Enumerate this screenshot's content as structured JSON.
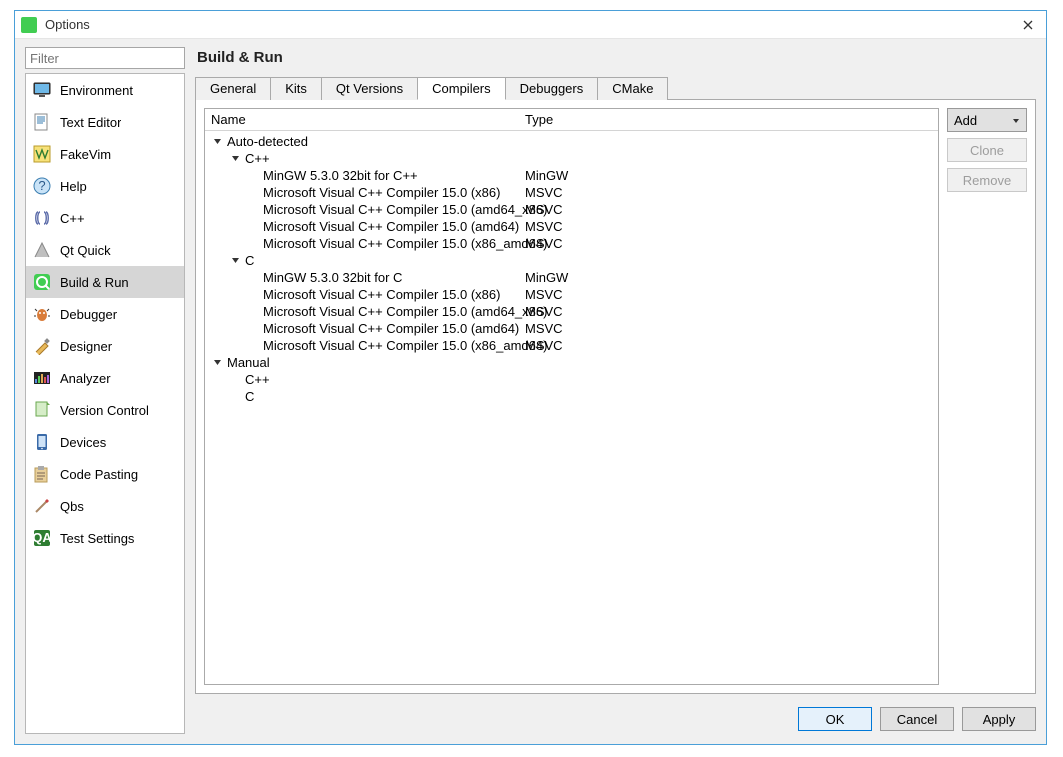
{
  "window": {
    "title": "Options"
  },
  "filter": {
    "placeholder": "Filter"
  },
  "sidebar": {
    "items": [
      {
        "id": "environment",
        "label": "Environment"
      },
      {
        "id": "text-editor",
        "label": "Text Editor"
      },
      {
        "id": "fakevim",
        "label": "FakeVim"
      },
      {
        "id": "help",
        "label": "Help"
      },
      {
        "id": "cpp",
        "label": "C++"
      },
      {
        "id": "qt-quick",
        "label": "Qt Quick"
      },
      {
        "id": "build-run",
        "label": "Build & Run"
      },
      {
        "id": "debugger",
        "label": "Debugger"
      },
      {
        "id": "designer",
        "label": "Designer"
      },
      {
        "id": "analyzer",
        "label": "Analyzer"
      },
      {
        "id": "version-control",
        "label": "Version Control"
      },
      {
        "id": "devices",
        "label": "Devices"
      },
      {
        "id": "code-pasting",
        "label": "Code Pasting"
      },
      {
        "id": "qbs",
        "label": "Qbs"
      },
      {
        "id": "test-settings",
        "label": "Test Settings"
      }
    ],
    "selected": "build-run"
  },
  "page": {
    "title": "Build & Run"
  },
  "tabs": {
    "items": [
      "General",
      "Kits",
      "Qt Versions",
      "Compilers",
      "Debuggers",
      "CMake"
    ],
    "active": "Compilers"
  },
  "tree": {
    "columns": {
      "name": "Name",
      "type": "Type"
    },
    "rows": [
      {
        "depth": 0,
        "exp": true,
        "name": "Auto-detected",
        "type": ""
      },
      {
        "depth": 1,
        "exp": true,
        "name": "C++",
        "type": ""
      },
      {
        "depth": 2,
        "exp": false,
        "name": "MinGW 5.3.0 32bit for C++",
        "type": "MinGW"
      },
      {
        "depth": 2,
        "exp": false,
        "name": "Microsoft Visual C++ Compiler 15.0 (x86)",
        "type": "MSVC"
      },
      {
        "depth": 2,
        "exp": false,
        "name": "Microsoft Visual C++ Compiler 15.0 (amd64_x86)",
        "type": "MSVC"
      },
      {
        "depth": 2,
        "exp": false,
        "name": "Microsoft Visual C++ Compiler 15.0 (amd64)",
        "type": "MSVC"
      },
      {
        "depth": 2,
        "exp": false,
        "name": "Microsoft Visual C++ Compiler 15.0 (x86_amd64)",
        "type": "MSVC"
      },
      {
        "depth": 1,
        "exp": true,
        "name": "C",
        "type": ""
      },
      {
        "depth": 2,
        "exp": false,
        "name": "MinGW 5.3.0 32bit for C",
        "type": "MinGW"
      },
      {
        "depth": 2,
        "exp": false,
        "name": "Microsoft Visual C++ Compiler 15.0 (x86)",
        "type": "MSVC"
      },
      {
        "depth": 2,
        "exp": false,
        "name": "Microsoft Visual C++ Compiler 15.0 (amd64_x86)",
        "type": "MSVC"
      },
      {
        "depth": 2,
        "exp": false,
        "name": "Microsoft Visual C++ Compiler 15.0 (amd64)",
        "type": "MSVC"
      },
      {
        "depth": 2,
        "exp": false,
        "name": "Microsoft Visual C++ Compiler 15.0 (x86_amd64)",
        "type": "MSVC"
      },
      {
        "depth": 0,
        "exp": true,
        "name": "Manual",
        "type": ""
      },
      {
        "depth": 1,
        "exp": false,
        "name": "C++",
        "type": ""
      },
      {
        "depth": 1,
        "exp": false,
        "name": "C",
        "type": ""
      }
    ]
  },
  "sideButtons": {
    "add": "Add",
    "clone": "Clone",
    "remove": "Remove"
  },
  "footer": {
    "ok": "OK",
    "cancel": "Cancel",
    "apply": "Apply"
  }
}
